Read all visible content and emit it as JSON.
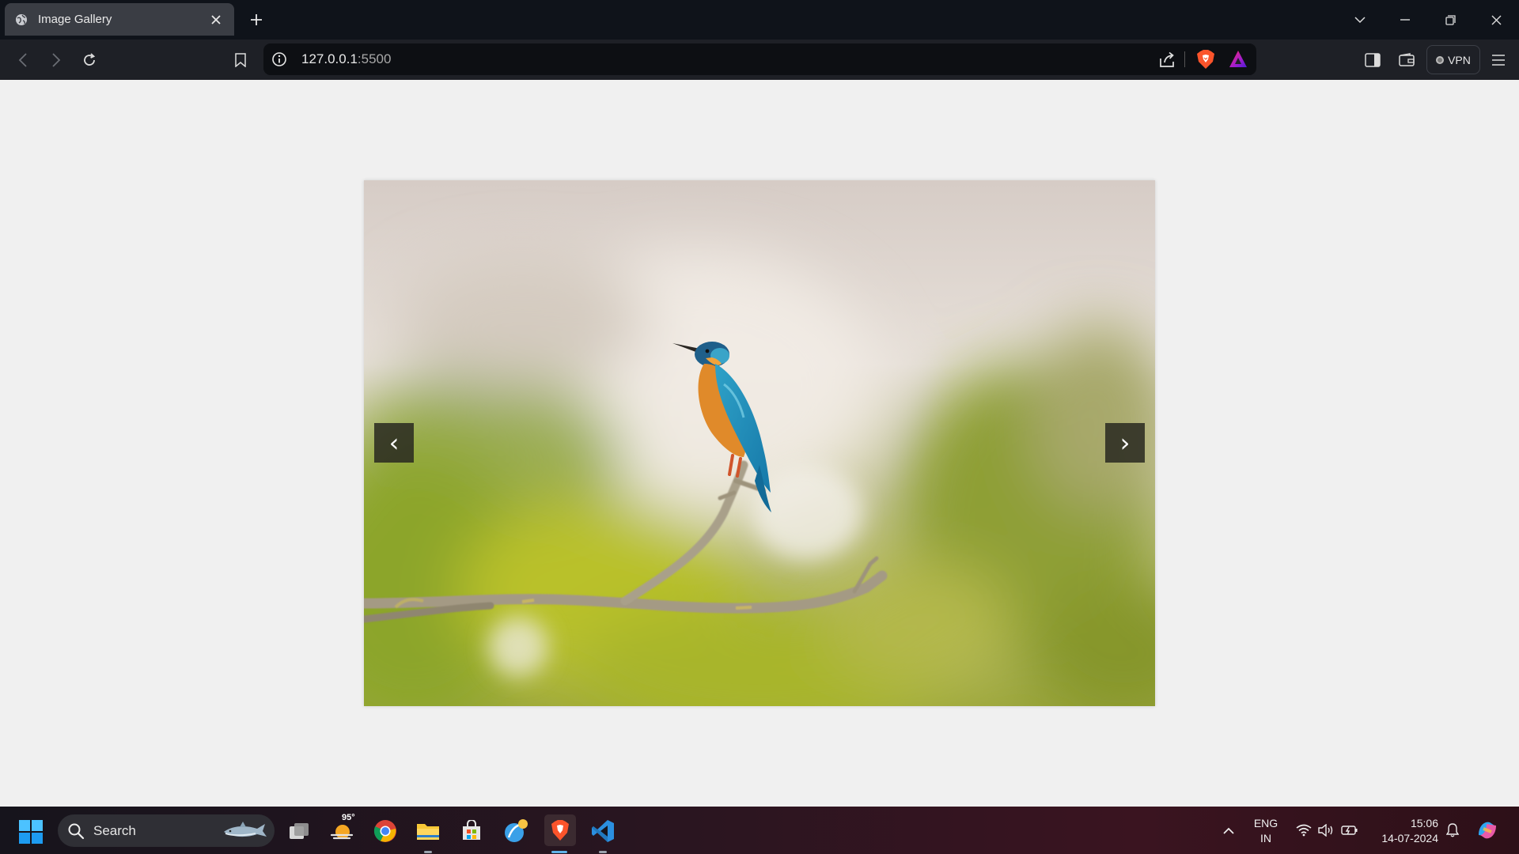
{
  "browser": {
    "tab_title": "Image Gallery",
    "url_host": "127.0.0.1",
    "url_port": ":5500",
    "vpn_label": "VPN"
  },
  "gallery": {
    "prev_label": "‹",
    "next_label": "›",
    "image_subject": "Kingfisher perched on a branch"
  },
  "taskbar": {
    "search_label": "Search",
    "weather_temp": "95°",
    "lang_line1": "ENG",
    "lang_line2": "IN",
    "time": "15:06",
    "date": "14-07-2024"
  },
  "colors": {
    "accent_vscode": "#2b8fe0",
    "brave_orange": "#fb542b",
    "page_bg": "#f0f0f0"
  }
}
